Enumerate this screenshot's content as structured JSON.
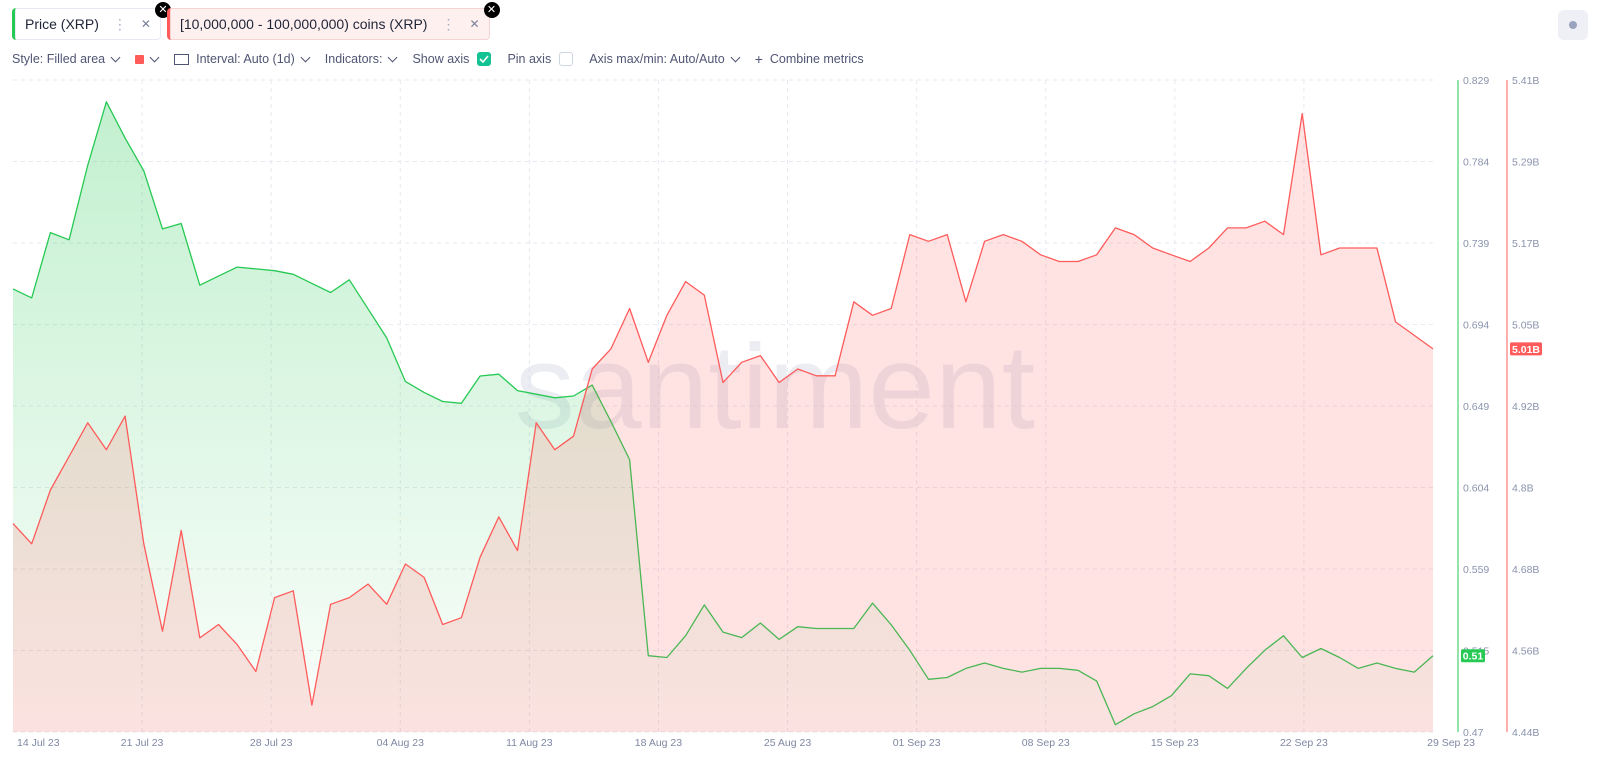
{
  "metrics": [
    {
      "label": "Price (XRP)",
      "color": "#26c953"
    },
    {
      "label": "[10,000,000 - 100,000,000) coins (XRP)",
      "color": "#ff5b5b"
    }
  ],
  "toolbar": {
    "style_label": "Style: Filled area",
    "interval_label": "Interval: Auto (1d)",
    "indicators_label": "Indicators:",
    "show_axis_label": "Show axis",
    "pin_axis_label": "Pin axis",
    "axis_maxmin_label": "Axis max/min: Auto/Auto",
    "combine_label": "Combine metrics"
  },
  "chart_data": {
    "type": "area",
    "watermark": "santiment",
    "x_ticks": [
      "14 Jul 23",
      "21 Jul 23",
      "28 Jul 23",
      "04 Aug 23",
      "11 Aug 23",
      "18 Aug 23",
      "25 Aug 23",
      "01 Sep 23",
      "08 Sep 23",
      "15 Sep 23",
      "22 Sep 23",
      "29 Sep 23"
    ],
    "x_range": [
      "2023-07-14",
      "2023-09-29"
    ],
    "series": [
      {
        "name": "Price (XRP)",
        "color": "#26c953",
        "axis": "left",
        "ylim": [
          0.47,
          0.829
        ],
        "ticks": [
          "0.829",
          "0.784",
          "0.739",
          "0.694",
          "0.649",
          "0.604",
          "0.559",
          "0.515",
          "0.47"
        ],
        "last_value_label": "0.51",
        "values": [
          0.714,
          0.709,
          0.745,
          0.741,
          0.782,
          0.817,
          0.797,
          0.779,
          0.747,
          0.75,
          0.716,
          0.721,
          0.726,
          0.725,
          0.724,
          0.722,
          0.717,
          0.712,
          0.719,
          0.703,
          0.687,
          0.663,
          0.657,
          0.652,
          0.651,
          0.666,
          0.667,
          0.658,
          0.656,
          0.654,
          0.655,
          0.661,
          0.641,
          0.62,
          0.512,
          0.511,
          0.523,
          0.54,
          0.525,
          0.522,
          0.53,
          0.521,
          0.528,
          0.527,
          0.527,
          0.527,
          0.541,
          0.529,
          0.515,
          0.499,
          0.5,
          0.505,
          0.508,
          0.505,
          0.503,
          0.505,
          0.505,
          0.504,
          0.498,
          0.474,
          0.48,
          0.484,
          0.49,
          0.502,
          0.501,
          0.494,
          0.505,
          0.515,
          0.523,
          0.511,
          0.516,
          0.511,
          0.505,
          0.508,
          0.505,
          0.503,
          0.512
        ]
      },
      {
        "name": "[10,000,000 - 100,000,000) coins (XRP)",
        "color": "#ff5b5b",
        "axis": "right",
        "ylim": [
          4.44,
          5.41
        ],
        "ticks": [
          "5.41B",
          "5.29B",
          "5.17B",
          "5.05B",
          "4.92B",
          "4.8B",
          "4.68B",
          "4.56B",
          "4.44B"
        ],
        "last_value_label": "5.01B",
        "values": [
          4.75,
          4.72,
          4.8,
          4.85,
          4.9,
          4.86,
          4.91,
          4.72,
          4.59,
          4.74,
          4.58,
          4.6,
          4.57,
          4.53,
          4.64,
          4.65,
          4.48,
          4.63,
          4.64,
          4.66,
          4.63,
          4.69,
          4.67,
          4.6,
          4.61,
          4.7,
          4.76,
          4.71,
          4.9,
          4.86,
          4.88,
          4.98,
          5.01,
          5.07,
          4.99,
          5.06,
          5.11,
          5.09,
          4.96,
          4.99,
          5.0,
          4.96,
          4.98,
          4.97,
          4.97,
          5.08,
          5.06,
          5.07,
          5.18,
          5.17,
          5.18,
          5.08,
          5.17,
          5.18,
          5.17,
          5.15,
          5.14,
          5.14,
          5.15,
          5.19,
          5.18,
          5.16,
          5.15,
          5.14,
          5.16,
          5.19,
          5.19,
          5.2,
          5.18,
          5.36,
          5.15,
          5.16,
          5.16,
          5.16,
          5.05,
          5.03,
          5.01
        ]
      }
    ]
  }
}
